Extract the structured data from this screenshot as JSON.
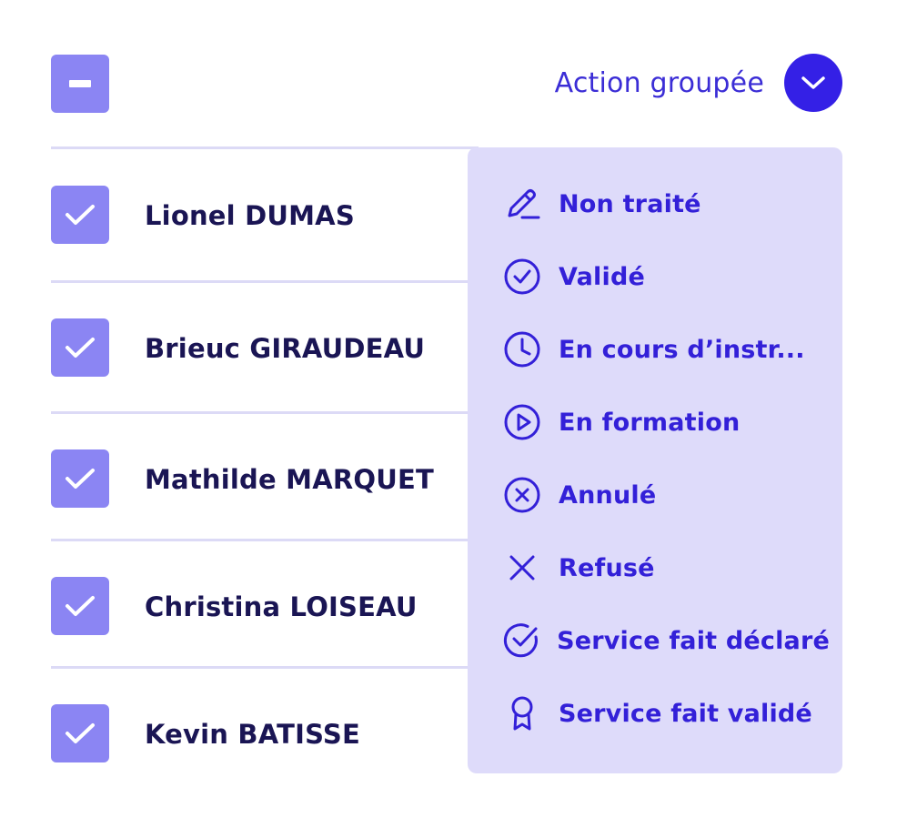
{
  "header": {
    "select_all_state": "indeterminate",
    "bulk_action_label": "Action groupée"
  },
  "rows": [
    {
      "name": "Lionel DUMAS",
      "checked": true
    },
    {
      "name": "Brieuc GIRAUDEAU",
      "checked": true
    },
    {
      "name": "Mathilde MARQUET",
      "checked": true
    },
    {
      "name": "Christina LOISEAU",
      "checked": true
    },
    {
      "name": "Kevin BATISSE",
      "checked": true
    }
  ],
  "menu": {
    "items": [
      {
        "label": "Non traité",
        "icon": "pencil-icon"
      },
      {
        "label": "Validé",
        "icon": "check-circle-icon"
      },
      {
        "label": "En cours d’instr...",
        "icon": "clock-icon"
      },
      {
        "label": "En formation",
        "icon": "play-circle-icon"
      },
      {
        "label": "Annulé",
        "icon": "x-circle-icon"
      },
      {
        "label": "Refusé",
        "icon": "x-icon"
      },
      {
        "label": "Service fait déclaré",
        "icon": "check-circle-open-icon"
      },
      {
        "label": "Service fait validé",
        "icon": "award-icon"
      }
    ]
  },
  "colors": {
    "checkbox": "#8b85f3",
    "accent": "#3420e6",
    "menu_bg": "#dedbfa",
    "menu_text": "#3320d8",
    "name_text": "#1a1554",
    "divider": "#dcdaf6"
  }
}
